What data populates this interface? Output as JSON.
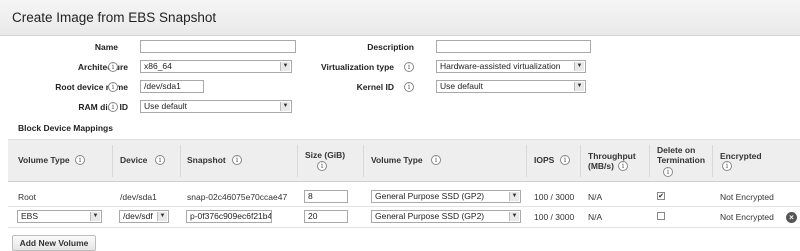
{
  "dialog": {
    "title": "Create Image from EBS Snapshot"
  },
  "form": {
    "name": {
      "label": "Name",
      "value": ""
    },
    "description": {
      "label": "Description",
      "value": ""
    },
    "architecture": {
      "label": "Architecture",
      "value": "x86_64"
    },
    "virtualization_type": {
      "label": "Virtualization type",
      "value": "Hardware-assisted virtualization"
    },
    "root_device_name": {
      "label": "Root device name",
      "value": "/dev/sda1"
    },
    "kernel_id": {
      "label": "Kernel ID",
      "value": "Use default"
    },
    "ram_disk_id": {
      "label": "RAM disk ID",
      "value": "Use default"
    },
    "info_glyph": "i"
  },
  "block_device": {
    "section_title": "Block Device Mappings",
    "columns": {
      "volume_type": "Volume Type",
      "device": "Device",
      "snapshot": "Snapshot",
      "size_line1": "Size (GiB)",
      "ebs_volume_type": "Volume Type",
      "iops": "IOPS",
      "throughput_line1": "Throughput",
      "throughput_line2": "(MB/s)",
      "delete_line1": "Delete on",
      "delete_line2": "Termination",
      "encrypted": "Encrypted"
    },
    "rows": [
      {
        "volume_type": "Root",
        "device": "/dev/sda1",
        "snapshot": "snap-02c46075e70ccae47",
        "size": "8",
        "ebs_volume_type": "General Purpose SSD (GP2)",
        "iops": "100 / 3000",
        "throughput": "N/A",
        "delete_on_termination": true,
        "delete_mark": "✔",
        "encrypted": "Not Encrypted"
      },
      {
        "volume_type": "EBS",
        "device": "/dev/sdf",
        "snapshot": "p-0f376c909ec6f21b4",
        "size": "20",
        "ebs_volume_type": "General Purpose SSD (GP2)",
        "iops": "100 / 3000",
        "throughput": "N/A",
        "delete_on_termination": false,
        "delete_mark": "",
        "encrypted": "Not Encrypted"
      }
    ],
    "remove_glyph": "×",
    "add_button": "Add New Volume"
  },
  "icons": {
    "dropdown": "▼"
  }
}
